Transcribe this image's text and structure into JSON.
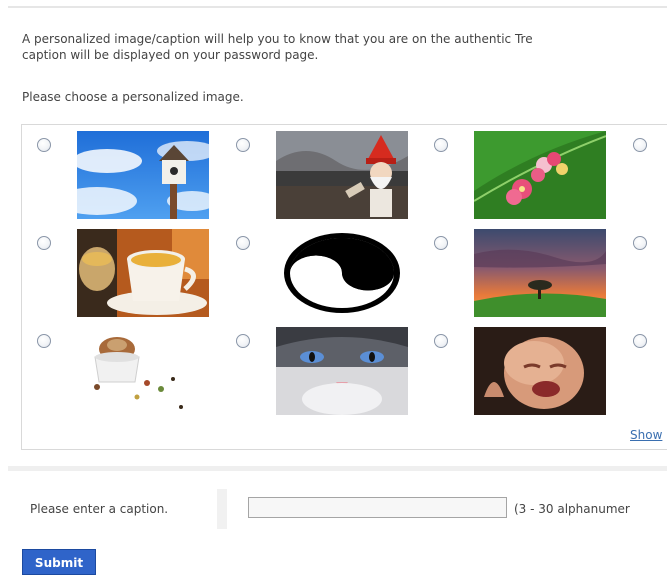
{
  "intro": {
    "line1": "A personalized image/caption will help you to know that you are on the authentic Tre",
    "line2": "caption will be displayed on your password page."
  },
  "choose_label": "Please choose a personalized image.",
  "images": [
    {
      "name": "birdhouse-sky-image",
      "selected": false
    },
    {
      "name": "garden-gnome-image",
      "selected": false
    },
    {
      "name": "pink-flowers-leaf-image",
      "selected": false
    },
    {
      "name": "tea-cup-image",
      "selected": false
    },
    {
      "name": "yin-yang-image",
      "selected": false
    },
    {
      "name": "sunset-tree-image",
      "selected": false
    },
    {
      "name": "hamster-in-cup-image",
      "selected": false
    },
    {
      "name": "cat-face-image",
      "selected": false
    },
    {
      "name": "crying-baby-image",
      "selected": false
    }
  ],
  "show_more_link": "Show",
  "caption": {
    "label": "Please enter a caption.",
    "value": "",
    "hint": "(3 - 30 alphanumer"
  },
  "submit_label": "Submit"
}
